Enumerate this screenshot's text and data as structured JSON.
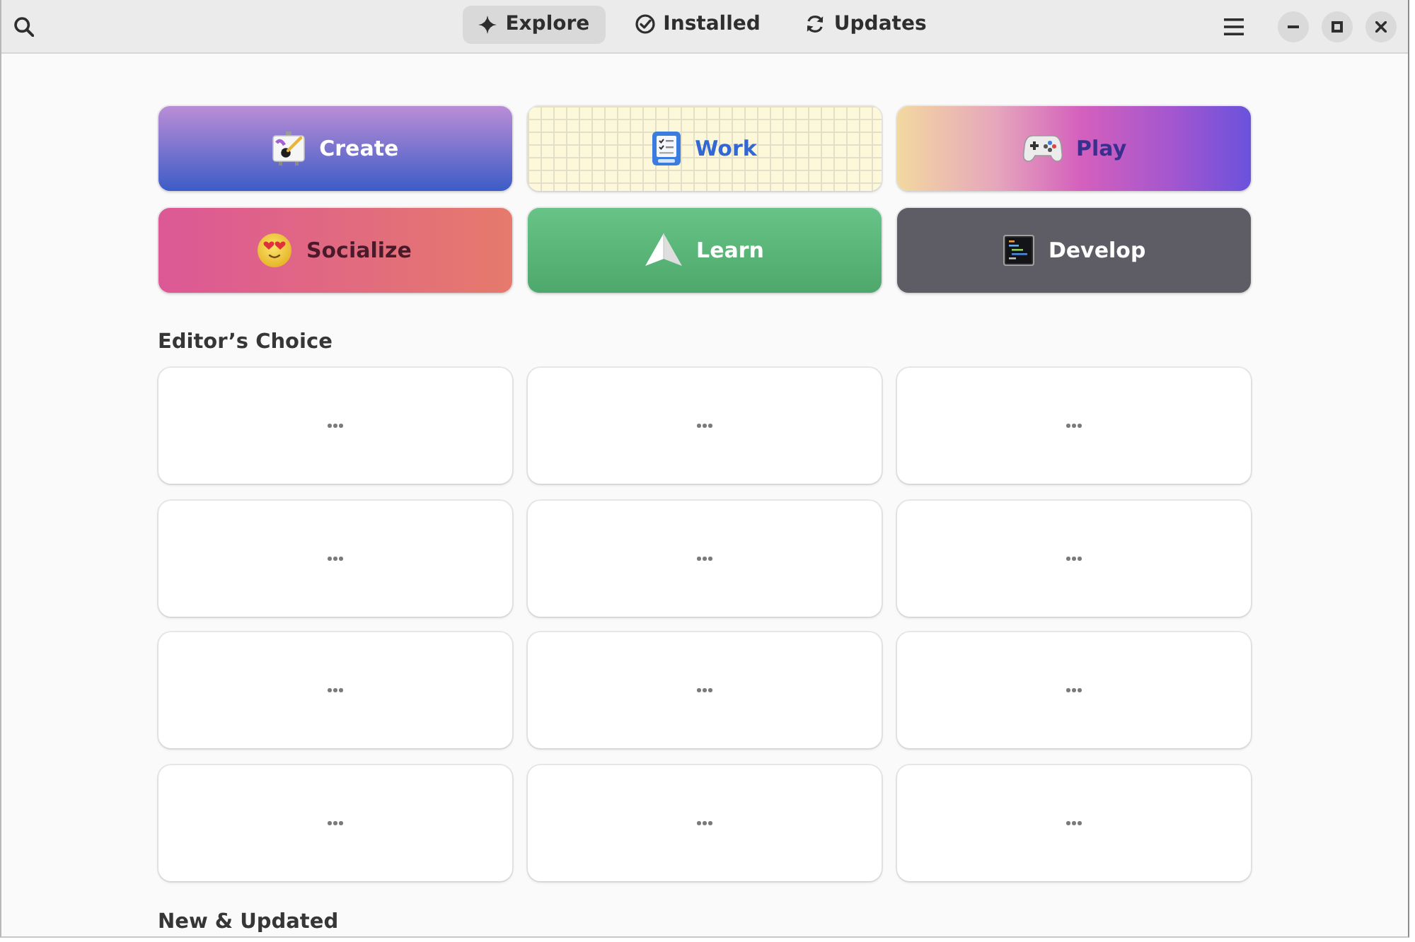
{
  "header": {
    "tabs": [
      {
        "label": "Explore",
        "selected": true
      },
      {
        "label": "Installed",
        "selected": false
      },
      {
        "label": "Updates",
        "selected": false
      }
    ]
  },
  "categories": [
    {
      "label": "Create",
      "kind": "art"
    },
    {
      "label": "Work",
      "kind": "office"
    },
    {
      "label": "Play",
      "kind": "games"
    },
    {
      "label": "Socialize",
      "kind": "social"
    },
    {
      "label": "Learn",
      "kind": "education"
    },
    {
      "label": "Develop",
      "kind": "programming"
    }
  ],
  "editors_choice": {
    "title": "Editor’s Choice",
    "tiles": [
      {
        "loading": true
      },
      {
        "loading": true
      },
      {
        "loading": true
      },
      {
        "loading": true
      },
      {
        "loading": true
      },
      {
        "loading": true
      },
      {
        "loading": true
      },
      {
        "loading": true
      },
      {
        "loading": true
      },
      {
        "loading": true
      },
      {
        "loading": true
      },
      {
        "loading": true
      }
    ]
  },
  "new_updated": {
    "title": "New & Updated"
  }
}
